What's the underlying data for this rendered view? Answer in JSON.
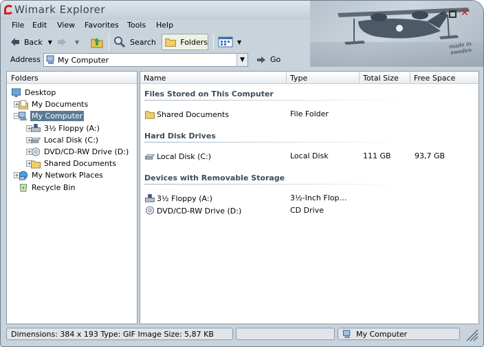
{
  "window": {
    "title": "Wimark Explorer",
    "badge_text": "made in sweden"
  },
  "menu": [
    "File",
    "Edit",
    "View",
    "Favorites",
    "Tools",
    "Help"
  ],
  "toolbar": {
    "back_label": "Back",
    "search_label": "Search",
    "folders_label": "Folders"
  },
  "address": {
    "label": "Address",
    "value": "My Computer",
    "go_label": "Go"
  },
  "left_panel": {
    "header": "Folders",
    "tree": [
      {
        "label": "Desktop",
        "icon": "desktop-icon",
        "expander": ""
      },
      {
        "label": "My Documents",
        "icon": "my-documents-icon",
        "expander": "+"
      },
      {
        "label": "My Computer",
        "icon": "computer-icon",
        "expander": "−",
        "selected": true
      },
      {
        "label": "3½ Floppy (A:)",
        "icon": "floppy-drive-icon",
        "expander": "+"
      },
      {
        "label": "Local Disk (C:)",
        "icon": "hard-disk-icon",
        "expander": "+"
      },
      {
        "label": "DVD/CD-RW Drive (D:)",
        "icon": "cd-drive-icon",
        "expander": "+"
      },
      {
        "label": "Shared Documents",
        "icon": "folder-icon",
        "expander": "+"
      },
      {
        "label": "My Network Places",
        "icon": "network-places-icon",
        "expander": "+"
      },
      {
        "label": "Recycle Bin",
        "icon": "recycle-bin-icon",
        "expander": ""
      }
    ]
  },
  "right_panel": {
    "columns": [
      "Name",
      "Type",
      "Total Size",
      "Free Space"
    ],
    "groups": [
      {
        "title": "Files Stored on This Computer",
        "items": [
          {
            "name": "Shared Documents",
            "type": "File Folder",
            "total": "",
            "free": "",
            "icon": "folder-icon"
          }
        ]
      },
      {
        "title": "Hard Disk Drives",
        "items": [
          {
            "name": "Local Disk (C:)",
            "type": "Local Disk",
            "total": "111 GB",
            "free": "93,7 GB",
            "icon": "hard-disk-icon"
          }
        ]
      },
      {
        "title": "Devices with Removable Storage",
        "items": [
          {
            "name": "3½ Floppy (A:)",
            "type": "3½-Inch Flop…",
            "total": "",
            "free": "",
            "icon": "floppy-drive-icon"
          },
          {
            "name": "DVD/CD-RW Drive (D:)",
            "type": "CD Drive",
            "total": "",
            "free": "",
            "icon": "cd-drive-icon"
          }
        ]
      }
    ]
  },
  "status": {
    "info": "Dimensions: 384 x 193 Type: GIF Image Size: 5,87 KB",
    "middle": "",
    "location": "My Computer"
  },
  "colors": {
    "selection": "#5b7a95",
    "close": "#c11b1b",
    "group_title": "#3d4c5a"
  }
}
